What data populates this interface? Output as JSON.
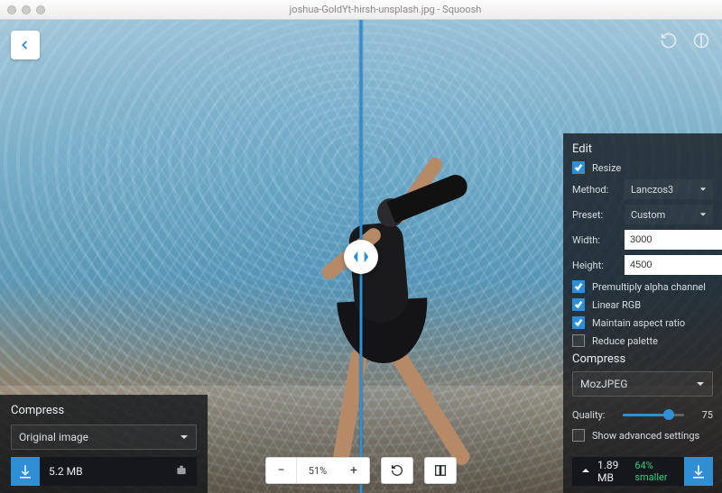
{
  "window": {
    "title": "joshua-GoldYt-hirsh-unsplash.jpg - Squoosh"
  },
  "top_icons": {
    "rotate_name": "rotate-icon",
    "theme_name": "contrast-icon"
  },
  "divider_handle_name": "compare-handle",
  "left_panel": {
    "heading": "Compress",
    "select_label": "Original image",
    "filesize": "5.2 MB"
  },
  "toolbar": {
    "zoom_out": "−",
    "zoom_label": "51%",
    "zoom_in": "+"
  },
  "right_panel": {
    "edit_heading": "Edit",
    "resize_label": "Resize",
    "resize_checked": true,
    "method_label": "Method:",
    "method_value": "Lanczos3",
    "preset_label": "Preset:",
    "preset_value": "Custom",
    "width_label": "Width:",
    "width_value": "3000",
    "height_label": "Height:",
    "height_value": "4500",
    "premul_label": "Premultiply alpha channel",
    "premul_checked": true,
    "linear_label": "Linear RGB",
    "linear_checked": true,
    "maintain_label": "Maintain aspect ratio",
    "maintain_checked": true,
    "reduce_label": "Reduce palette",
    "reduce_checked": false,
    "compress_heading": "Compress",
    "encoder_value": "MozJPEG",
    "quality_label": "Quality:",
    "quality_value": "75",
    "quality_percent": 75,
    "adv_label": "Show advanced settings",
    "adv_checked": false,
    "filesize": "1.89 MB",
    "smaller": "64% smaller"
  }
}
